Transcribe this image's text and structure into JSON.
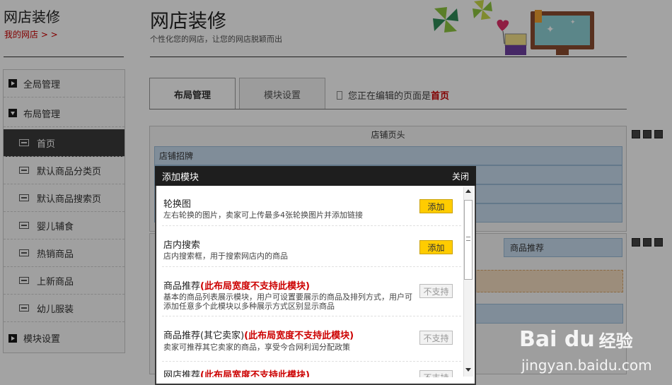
{
  "sidebar": {
    "title": "网店装修",
    "link": "我的网店 > >",
    "items": [
      {
        "label": "全局管理",
        "kind": "group",
        "state": "collapsed"
      },
      {
        "label": "布局管理",
        "kind": "group",
        "state": "expanded"
      },
      {
        "label": "首页",
        "kind": "sub",
        "active": true
      },
      {
        "label": "默认商品分类页",
        "kind": "sub"
      },
      {
        "label": "默认商品搜索页",
        "kind": "sub"
      },
      {
        "label": "婴儿辅食",
        "kind": "sub"
      },
      {
        "label": "热销商品",
        "kind": "sub"
      },
      {
        "label": "上新商品",
        "kind": "sub"
      },
      {
        "label": "幼儿服装",
        "kind": "sub"
      },
      {
        "label": "模块设置",
        "kind": "group",
        "state": "collapsed"
      }
    ]
  },
  "header": {
    "title": "网店装修",
    "subtitle": "个性化您的网店，让您的网店脱颖而出"
  },
  "tabs": [
    {
      "label": "布局管理",
      "active": true
    },
    {
      "label": "模块设置",
      "active": false
    }
  ],
  "editing": {
    "prefix": "您正在编辑的页面是",
    "page": "首页"
  },
  "layout": {
    "header_region": "店铺页头",
    "banner": "店铺招牌",
    "product_recommend_col": "商品推荐"
  },
  "modal": {
    "title": "添加模块",
    "close": "关闭",
    "modules": [
      {
        "name": "轮换图",
        "warn": "",
        "desc": "左右轮换的图片，卖家可上传最多4张轮换图片并添加链接",
        "action": "添加",
        "supported": true
      },
      {
        "name": "店内搜索",
        "warn": "",
        "desc": "店内搜索框，用于搜索网店内的商品",
        "action": "添加",
        "supported": true
      },
      {
        "name": "商品推荐",
        "warn": "(此布局宽度不支持此模块)",
        "desc": "基本的商品列表展示模块，用户可设置要展示的商品及排列方式，用户可添加任意多个此模块以多种展示方式区别显示商品",
        "action": "不支持",
        "supported": false
      },
      {
        "name": "商品推荐(其它卖家)",
        "warn": "(此布局宽度不支持此模块)",
        "desc": "卖家可推荐其它卖家的商品，享受今合网利润分配政策",
        "action": "不支持",
        "supported": false
      },
      {
        "name": "网店推荐",
        "warn": "(此布局宽度不支持此模块)",
        "desc": "",
        "action": "不支持",
        "supported": false
      }
    ]
  },
  "watermark": {
    "logo": "Bai du",
    "cn": "经验",
    "url": "jingyan.baidu.com"
  },
  "colors": {
    "accent_red": "#cc0000",
    "add_button": "#ffcc00",
    "modal_header": "#1e1e1e",
    "layout_blue": "#c8ddf0"
  }
}
